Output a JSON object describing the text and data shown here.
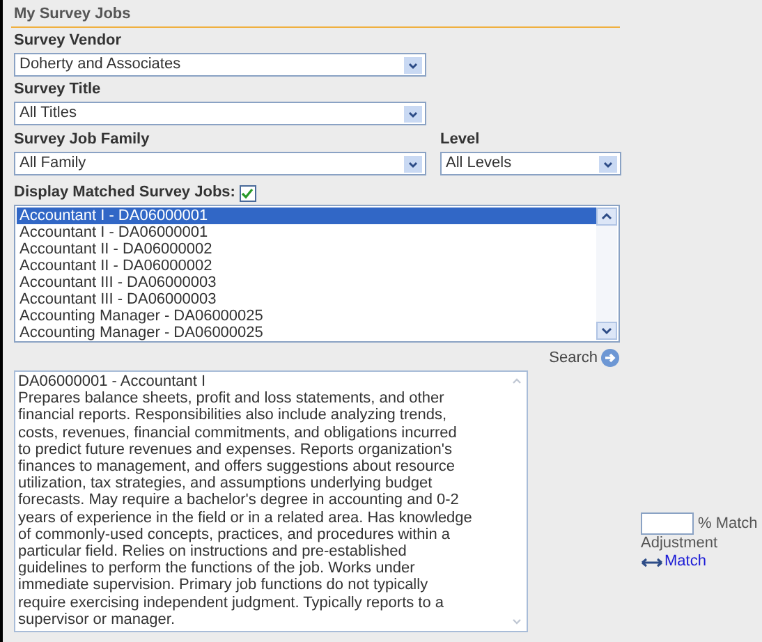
{
  "section_title": "My Survey Jobs",
  "vendor": {
    "label": "Survey Vendor",
    "value": "Doherty and Associates"
  },
  "title": {
    "label": "Survey Title",
    "value": "All Titles"
  },
  "family": {
    "label": "Survey Job Family",
    "value": "All Family"
  },
  "level": {
    "label": "Level",
    "value": "All Levels"
  },
  "display_matched": {
    "label": "Display Matched Survey Jobs:",
    "checked": true
  },
  "jobs": [
    {
      "text": "Accountant I - DA06000001",
      "selected": true
    },
    {
      "text": "Accountant I - DA06000001",
      "selected": false
    },
    {
      "text": "Accountant II - DA06000002",
      "selected": false
    },
    {
      "text": "Accountant II - DA06000002",
      "selected": false
    },
    {
      "text": "Accountant III - DA06000003",
      "selected": false
    },
    {
      "text": "Accountant III - DA06000003",
      "selected": false
    },
    {
      "text": "Accounting Manager - DA06000025",
      "selected": false
    },
    {
      "text": "Accounting Manager - DA06000025",
      "selected": false
    }
  ],
  "search_button": "Search",
  "description_lines": [
    "DA06000001 - Accountant I",
    "Prepares balance sheets, profit and loss statements, and other",
    "financial reports. Responsibilities also include analyzing trends,",
    "costs, revenues, financial commitments, and obligations incurred",
    "to predict future revenues and expenses. Reports organization's",
    "finances to management, and offers suggestions about resource",
    "utilization, tax strategies, and assumptions underlying budget",
    "forecasts. May require a bachelor's degree in accounting and 0-2",
    "years of experience in the field or in a related area. Has knowledge",
    "of commonly-used concepts, practices, and procedures within a",
    "particular field. Relies on instructions and pre-established",
    "guidelines to perform the functions of the job. Works under",
    "immediate supervision. Primary job functions do not typically",
    "require exercising independent judgment. Typically reports to a",
    "supervisor or manager."
  ],
  "match_adjustment": {
    "suffix": "% Match",
    "label": "Adjustment"
  },
  "match_link": "Match"
}
